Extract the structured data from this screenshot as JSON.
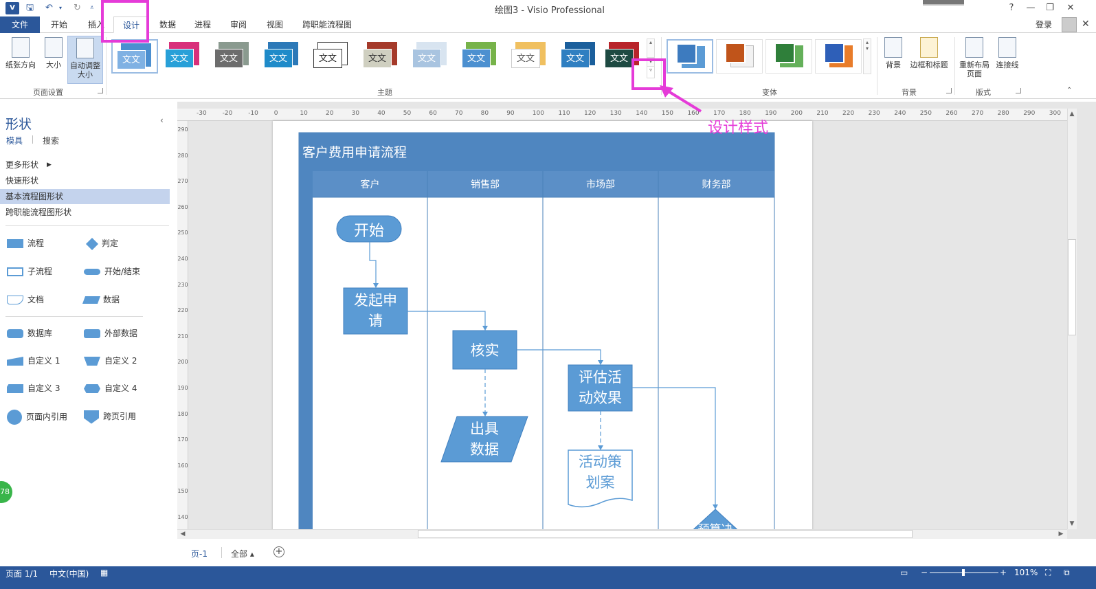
{
  "app": {
    "icon_text": "V",
    "window_title": "绘图3 - Visio Professional"
  },
  "window_controls": {
    "help": "?",
    "minimize": "—",
    "restore": "❐",
    "close": "✕"
  },
  "tabs": [
    {
      "label": "文件"
    },
    {
      "label": "开始"
    },
    {
      "label": "插入"
    },
    {
      "label": "设计"
    },
    {
      "label": "数据"
    },
    {
      "label": "进程"
    },
    {
      "label": "审阅"
    },
    {
      "label": "视图"
    },
    {
      "label": "跨职能流程图"
    }
  ],
  "account": {
    "login": "登录",
    "ribbon_close": "✕"
  },
  "ribbon": {
    "page_setup": {
      "orientation": "纸张方向",
      "size": "大小",
      "auto_size_line1": "自动调整",
      "auto_size_line2": "大小",
      "group_label": "页面设置"
    },
    "themes": {
      "group_label": "主题",
      "item_text": "文文"
    },
    "variants": {
      "group_label": "变体"
    },
    "backgrounds": {
      "background": "背景",
      "borders_titles": "边框和标题",
      "group_label": "背景"
    },
    "layout": {
      "relayout_line1": "重新布局",
      "relayout_line2": "页面",
      "connectors": "连接线",
      "group_label": "版式"
    }
  },
  "annotation": {
    "label": "设计样式"
  },
  "shapes_panel": {
    "title": "形状",
    "tab_stencils": "模具",
    "tab_search": "搜索",
    "more_shapes": "更多形状",
    "quick_shapes": "快速形状",
    "basic_flowchart": "基本流程图形状",
    "cross_functional": "跨职能流程图形状",
    "shapes": [
      {
        "name": "流程"
      },
      {
        "name": "判定"
      },
      {
        "name": "子流程"
      },
      {
        "name": "开始/结束"
      },
      {
        "name": "文档"
      },
      {
        "name": "数据"
      },
      {
        "name": "数据库"
      },
      {
        "name": "外部数据"
      },
      {
        "name": "自定义 1"
      },
      {
        "name": "自定义 2"
      },
      {
        "name": "自定义 3"
      },
      {
        "name": "自定义 4"
      },
      {
        "name": "页面内引用"
      },
      {
        "name": "跨页引用"
      }
    ],
    "badge": "78"
  },
  "rulers": {
    "h": [
      "-30",
      "-20",
      "-10",
      "0",
      "10",
      "20",
      "30",
      "40",
      "50",
      "60",
      "70",
      "80",
      "90",
      "100",
      "110",
      "120",
      "130",
      "140",
      "150",
      "160",
      "170",
      "180",
      "190",
      "200",
      "210",
      "220",
      "230",
      "240",
      "250",
      "260",
      "270",
      "280",
      "290",
      "300"
    ],
    "v": [
      "290",
      "280",
      "270",
      "260",
      "250",
      "240",
      "230",
      "220",
      "210",
      "200",
      "190",
      "180",
      "170",
      "160",
      "150",
      "140"
    ]
  },
  "diagram": {
    "title": "客户费用申请流程",
    "lanes": [
      "客户",
      "销售部",
      "市场部",
      "财务部"
    ],
    "shapes": {
      "start": "开始",
      "apply_l1": "发起申",
      "apply_l2": "请",
      "verify": "核实",
      "data_l1": "出具",
      "data_l2": "数据",
      "eval_l1": "评估活",
      "eval_l2": "动效果",
      "plan_l1": "活动策",
      "plan_l2": "划案",
      "budget_partial": "预算决"
    }
  },
  "page_tabs": {
    "page1": "页-1",
    "all": "全部 ▴",
    "add": "+"
  },
  "status": {
    "page": "页面 1/1",
    "language": "中文(中国)",
    "zoom": "101%"
  },
  "colors": {
    "accent": "#2b579a",
    "shape_fill": "#5b9bd5",
    "lane_header": "#5b8fc7",
    "annotation": "#e53bd8"
  }
}
